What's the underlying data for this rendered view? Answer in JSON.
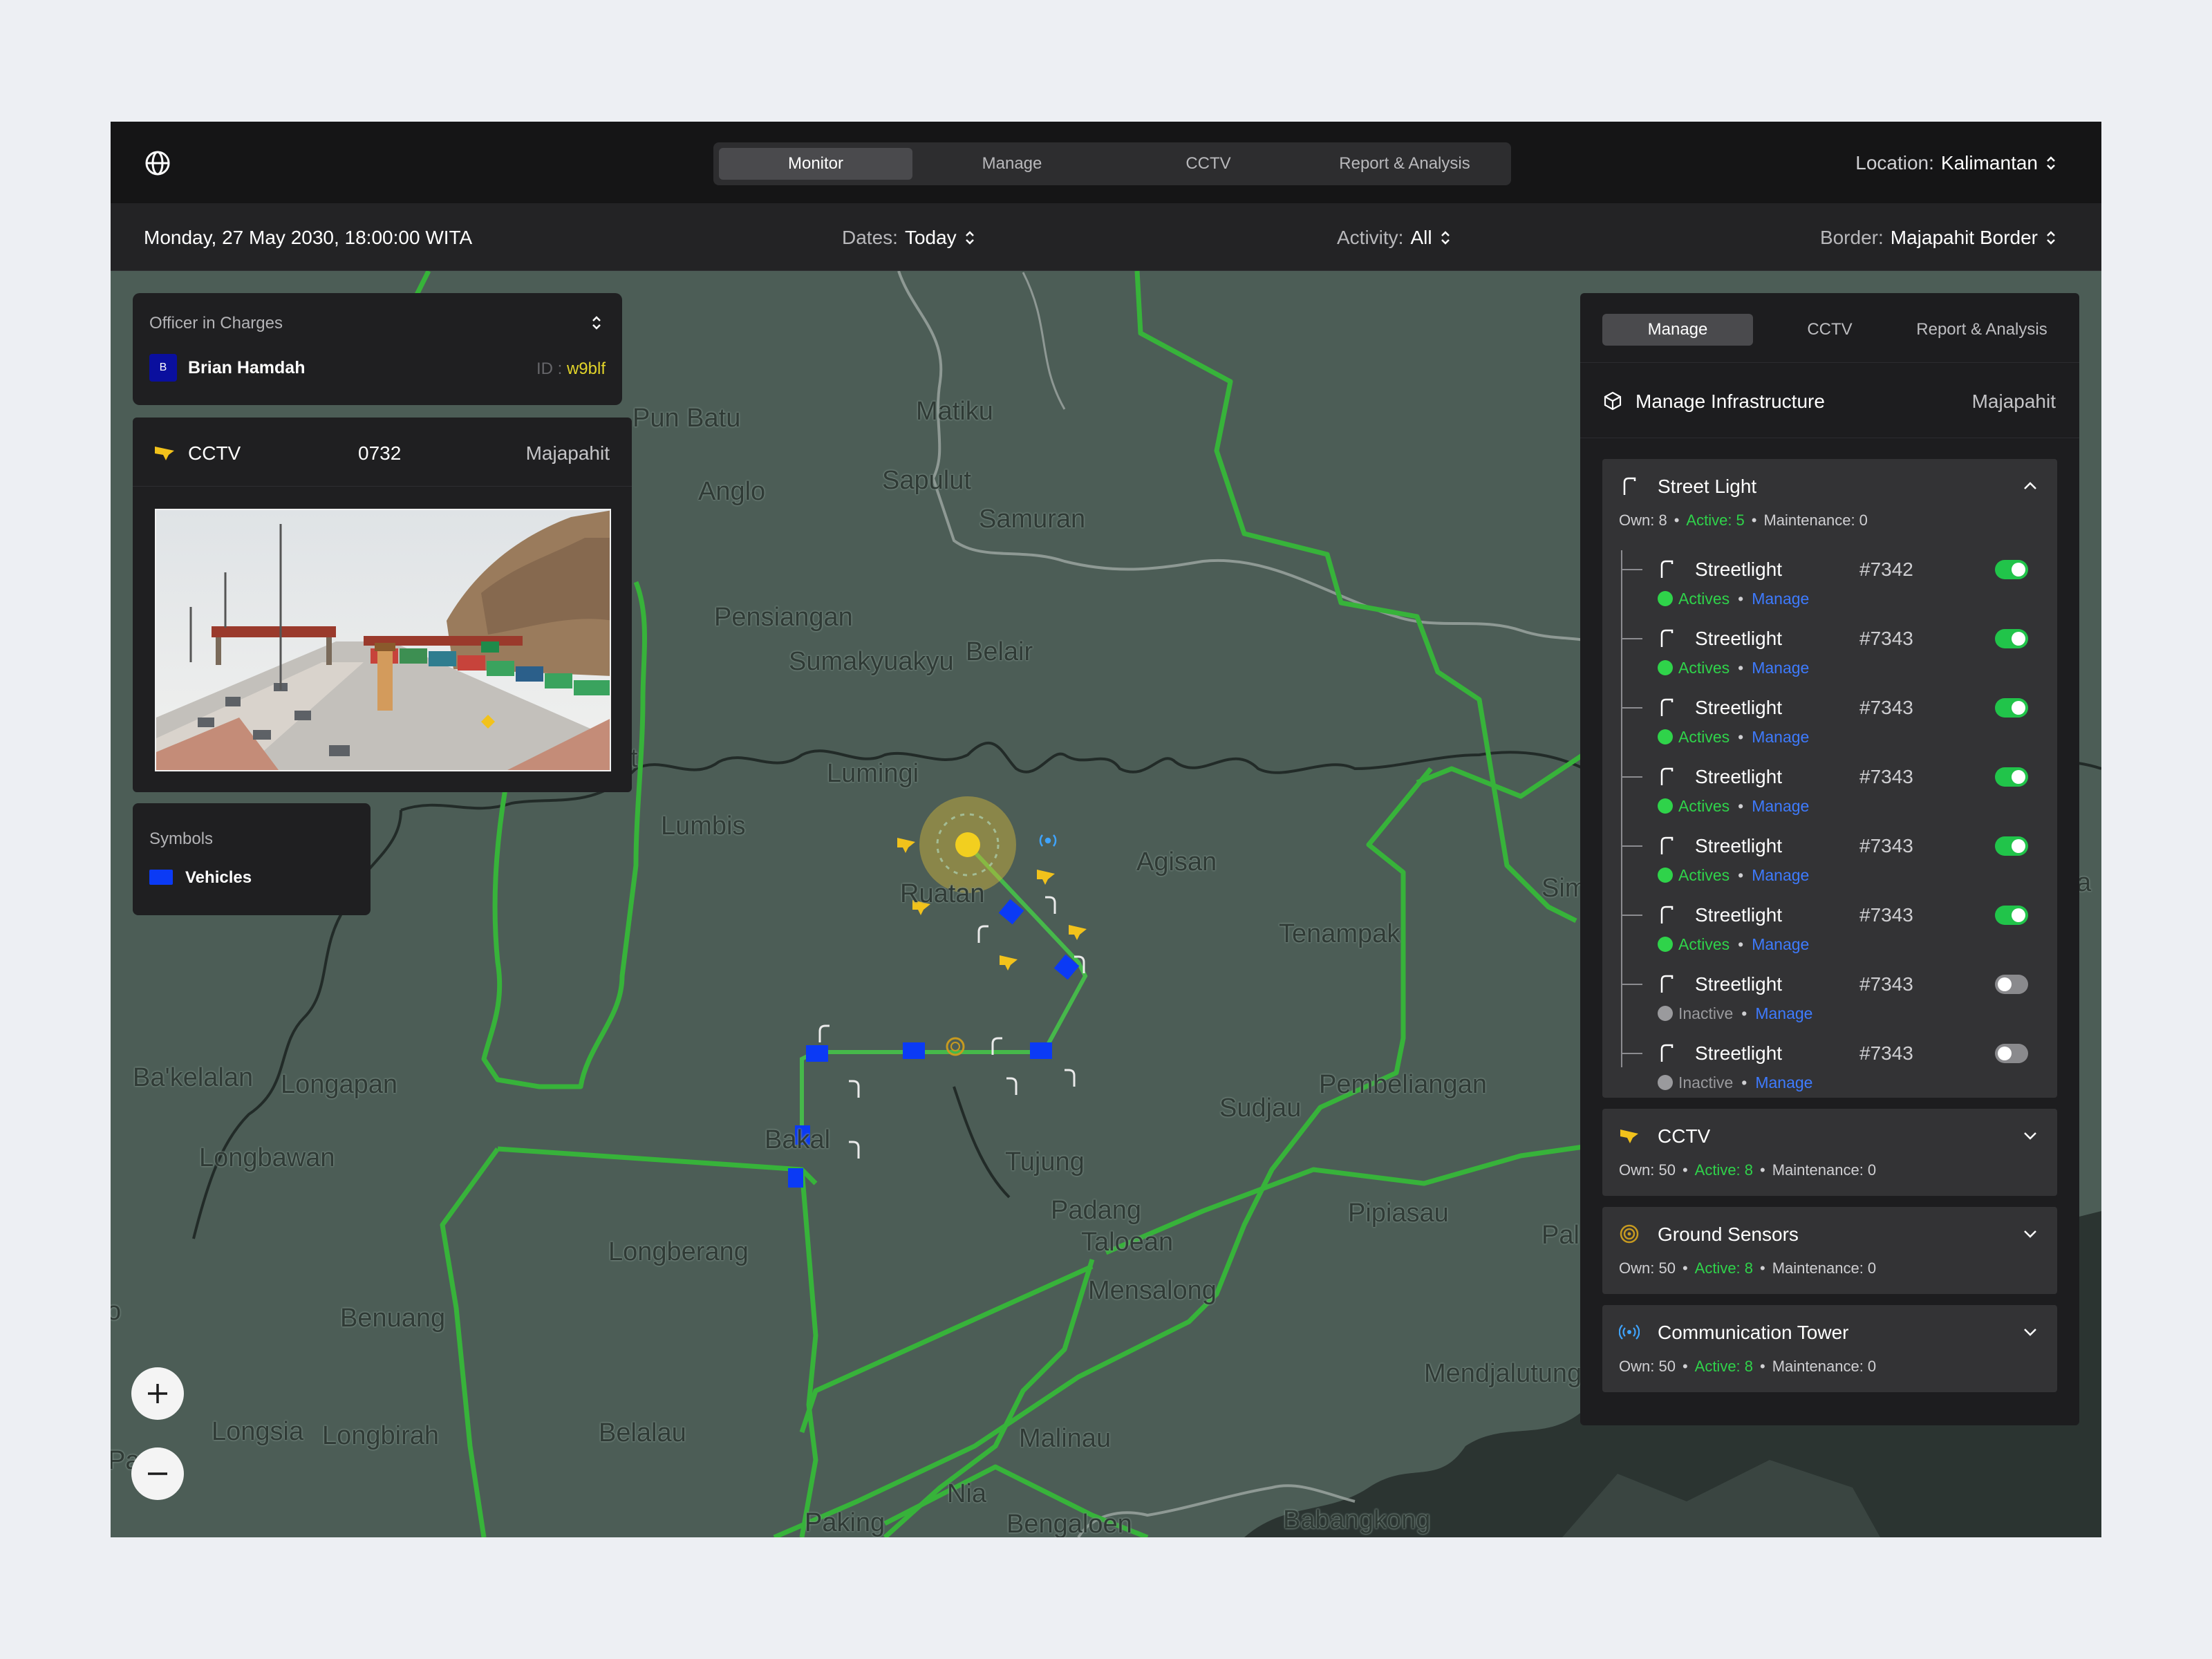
{
  "topnav": {
    "tabs": [
      "Monitor",
      "Manage",
      "CCTV",
      "Report & Analysis"
    ],
    "active": "Monitor",
    "location_label": "Location:",
    "location_value": "Kalimantan"
  },
  "filters": {
    "datetime": "Monday, 27 May 2030, 18:00:00 WITA",
    "dates_label": "Dates:",
    "dates_value": "Today",
    "activity_label": "Activity:",
    "activity_value": "All",
    "border_label": "Border:",
    "border_value": "Majapahit Border"
  },
  "officer": {
    "title": "Officer in Charges",
    "avatar_letter": "B",
    "name": "Brian Hamdah",
    "id_label": "ID :",
    "id_value": "w9blf"
  },
  "cctv_panel": {
    "label": "CCTV",
    "number": "0732",
    "location": "Majapahit"
  },
  "symbols": {
    "title": "Symbols",
    "items": [
      {
        "label": "Vehicles",
        "color": "#0b3af5"
      }
    ]
  },
  "map": {
    "places": [
      "Pun Batu",
      "Matiku",
      "Anglo",
      "Sapulut",
      "Samuran",
      "Pensiangan",
      "Belair",
      "Sumakyuakyu",
      "Lumingi",
      "Lumbis",
      "Agisan",
      "Ruatan",
      "Siman",
      "Tenampak",
      "Ba'kelalan",
      "Longapan",
      "Pembeliangan",
      "Sudjau",
      "Bakal",
      "Tujung",
      "Longbawan",
      "Padang",
      "Pipiasau",
      "Pal",
      "Taloean",
      "Longberang",
      "Mensalong",
      "Benuang",
      "Mendjalutung",
      "Longsia",
      "Longbirah",
      "Belalau",
      "Malinau",
      "Nia",
      "Bengaloen",
      "Paking",
      "Babangkong",
      "a",
      "Pa",
      "t",
      "o"
    ],
    "zoom_in": "+",
    "zoom_out": "−"
  },
  "right_panel": {
    "tabs": [
      "Manage",
      "CCTV",
      "Report & Analysis"
    ],
    "active_tab": "Manage",
    "title": "Manage Infrastructure",
    "region": "Majapahit",
    "street_light": {
      "title": "Street Light",
      "own": "Own: 8",
      "active": "Active: 5",
      "maintenance": "Maintenance: 0",
      "items": [
        {
          "name": "Streetlight",
          "code": "#7342",
          "status": "Actives",
          "on": true,
          "manage": "Manage"
        },
        {
          "name": "Streetlight",
          "code": "#7343",
          "status": "Actives",
          "on": true,
          "manage": "Manage"
        },
        {
          "name": "Streetlight",
          "code": "#7343",
          "status": "Actives",
          "on": true,
          "manage": "Manage"
        },
        {
          "name": "Streetlight",
          "code": "#7343",
          "status": "Actives",
          "on": true,
          "manage": "Manage"
        },
        {
          "name": "Streetlight",
          "code": "#7343",
          "status": "Actives",
          "on": true,
          "manage": "Manage"
        },
        {
          "name": "Streetlight",
          "code": "#7343",
          "status": "Actives",
          "on": true,
          "manage": "Manage"
        },
        {
          "name": "Streetlight",
          "code": "#7343",
          "status": "Inactive",
          "on": false,
          "manage": "Manage"
        },
        {
          "name": "Streetlight",
          "code": "#7343",
          "status": "Inactive",
          "on": false,
          "manage": "Manage"
        }
      ]
    },
    "cctv": {
      "title": "CCTV",
      "own": "Own: 50",
      "active": "Active: 8",
      "maintenance": "Maintenance: 0"
    },
    "ground_sensors": {
      "title": "Ground Sensors",
      "own": "Own: 50",
      "active": "Active: 8",
      "maintenance": "Maintenance: 0"
    },
    "comm_tower": {
      "title": "Communication Tower",
      "own": "Own: 50",
      "active": "Active: 8",
      "maintenance": "Maintenance: 0"
    }
  },
  "colors": {
    "accent_green": "#2fd34a",
    "link_blue": "#3e7bff",
    "vehicle_blue": "#0b3af5",
    "cctv_yellow": "#f2c21b",
    "id_yellow": "#e3d52a",
    "map_bg": "#4c5d56",
    "route_green": "#37b33a"
  }
}
